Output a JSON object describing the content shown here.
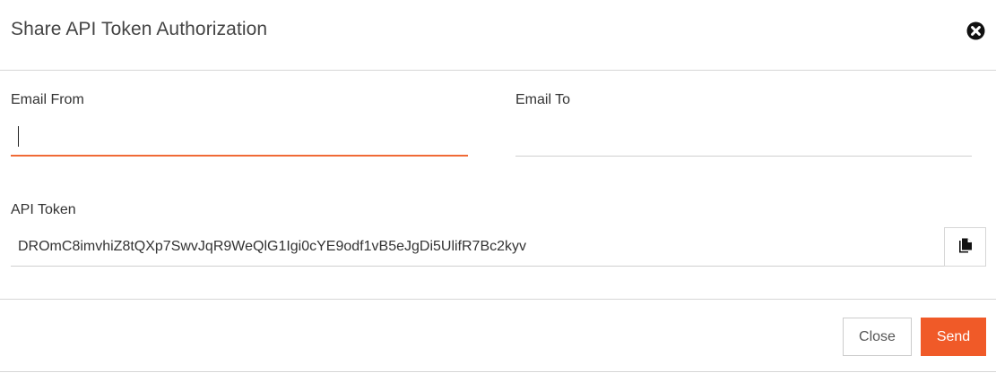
{
  "dialog": {
    "title": "Share API Token Authorization",
    "close_icon": "close-circle-icon"
  },
  "form": {
    "email_from": {
      "label": "Email From",
      "value": "",
      "placeholder": "",
      "focused": true
    },
    "email_to": {
      "label": "Email To",
      "value": "",
      "placeholder": ""
    },
    "api_token": {
      "label": "API Token",
      "value": "DROmC8imvhiZ8tQXp7SwvJqR9WeQlG1Igi0cYE9odf1vB5eJgDi5UlifR7Bc2kyv",
      "copy_icon": "copy-icon"
    }
  },
  "footer": {
    "close_label": "Close",
    "send_label": "Send"
  },
  "colors": {
    "accent": "#f05a28",
    "focus_underline": "#f06a35",
    "border": "#d6d6d6",
    "text": "#333333"
  }
}
